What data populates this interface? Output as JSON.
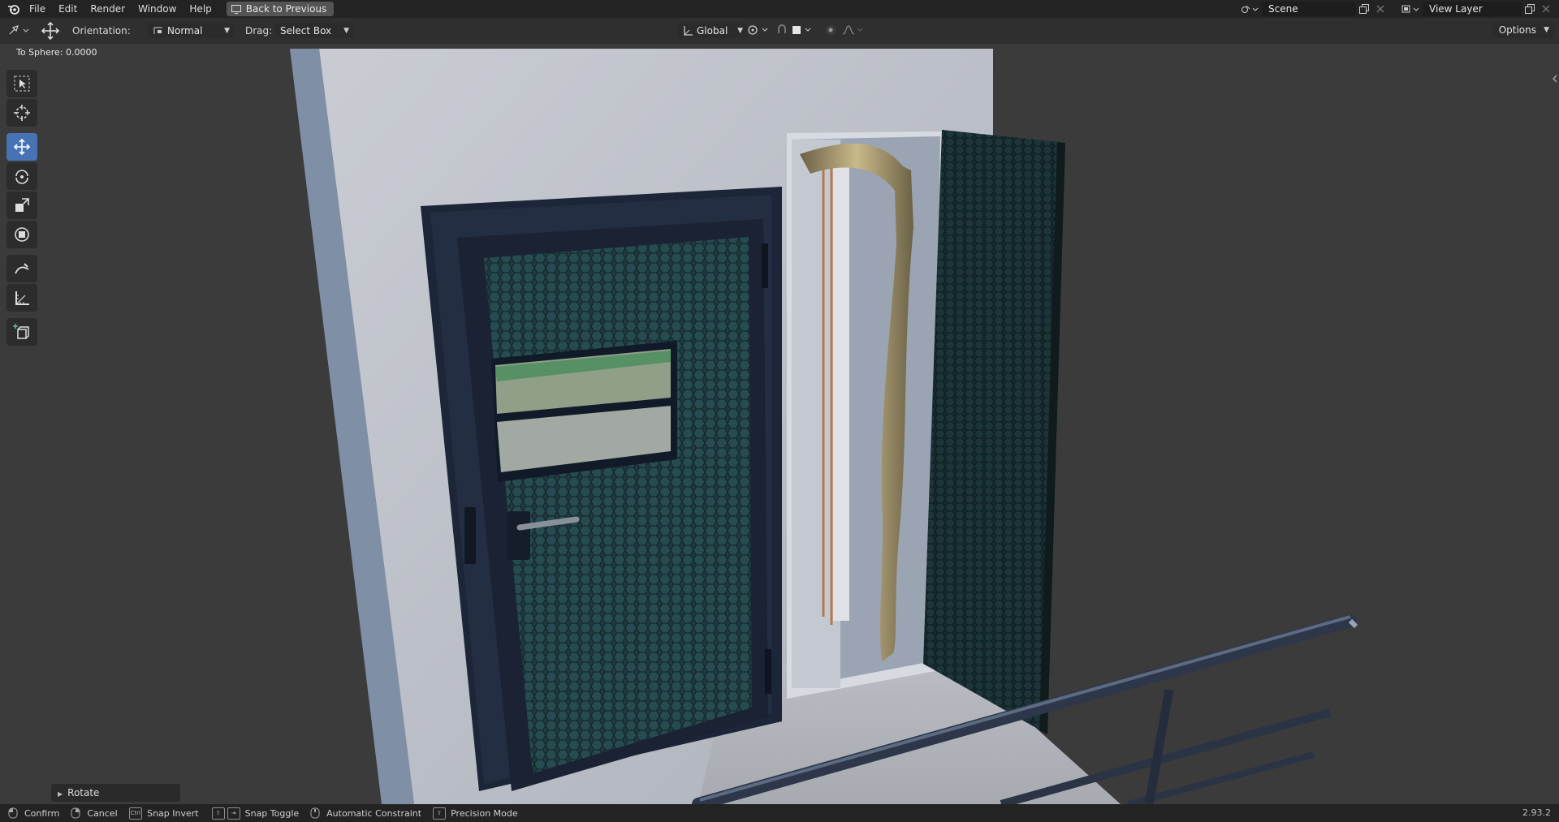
{
  "menu": {
    "items": [
      "File",
      "Edit",
      "Render",
      "Window",
      "Help"
    ],
    "back_button": "Back to Previous"
  },
  "scene": {
    "name": "Scene"
  },
  "view_layer": {
    "name": "View Layer"
  },
  "header": {
    "orientation_label": "Orientation:",
    "orientation_value": "Normal",
    "drag_label": "Drag:",
    "drag_value": "Select Box",
    "transform_space": "Global",
    "options_label": "Options"
  },
  "viewport": {
    "operator_readout": "To Sphere: 0.0000"
  },
  "last_operator_panel": {
    "label": "Rotate"
  },
  "status": {
    "confirm": "Confirm",
    "cancel": "Cancel",
    "snap_invert": "Snap Invert",
    "snap_toggle": "Snap Toggle",
    "automatic_constraint": "Automatic Constraint",
    "precision_mode": "Precision Mode",
    "ctrl_key": "Ctrl",
    "version": "2.93.2"
  },
  "toolbar": {
    "tools": [
      "select-box-icon",
      "cursor-icon",
      "move-icon",
      "rotate-icon",
      "scale-icon",
      "transform-icon",
      "annotate-icon",
      "measure-icon",
      "add-cube-icon"
    ],
    "active_tool": "move-icon"
  },
  "colors": {
    "accent": "#4772b3"
  }
}
